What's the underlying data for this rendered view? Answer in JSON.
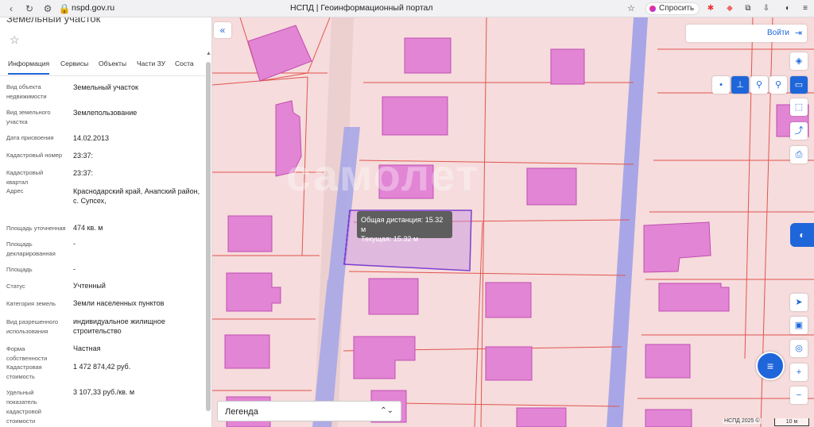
{
  "browser": {
    "url": "nspd.gov.ru",
    "tab_title": "НСПД | Геоинформационный портал",
    "ask_label": "Спросить",
    "icons": [
      "back-icon",
      "reload-icon",
      "site-settings-icon",
      "bookmark-icon",
      "extensions-icon",
      "download-icon",
      "menu-icon"
    ]
  },
  "panel": {
    "title": "Земельный участок",
    "tabs": [
      "Информация",
      "Сервисы",
      "Объекты",
      "Части ЗУ",
      "Соста"
    ],
    "rows": [
      {
        "label": "Вид объекта недвижимости",
        "value": "Земельный участок"
      },
      {
        "label": "Вид земельного участка",
        "value": "Землепользование"
      },
      {
        "label": "Дата присвоения",
        "value": "14.02.2013"
      },
      {
        "label": "Кадастровый номер",
        "value": "23:37:"
      },
      {
        "label": "Кадастровый квартал",
        "value": "23:37:"
      },
      {
        "label": "Адрес",
        "value": "Краснодарский край, Анапский район, с. Супсех,"
      },
      {
        "label": "Площадь уточненная",
        "value": "474 кв. м"
      },
      {
        "label": "Площадь декларированная",
        "value": "-"
      },
      {
        "label": "Площадь",
        "value": "-"
      },
      {
        "label": "Статус",
        "value": "Учтенный"
      },
      {
        "label": "Категория земель",
        "value": "Земли населенных пунктов"
      },
      {
        "label": "Вид разрешенного использования",
        "value": "индивидуальное жилищное строительство"
      },
      {
        "label": "Форма собственности",
        "value": "Частная"
      },
      {
        "label": "Кадастровая стоимость",
        "value": "1 472 874,42 руб."
      },
      {
        "label": "Удельный показатель кадастровой стоимости",
        "value": "3 107,33 руб./кв. м"
      }
    ]
  },
  "map": {
    "login_label": "Войти",
    "tooltip_total": "Общая дистанция: 15.32 м",
    "tooltip_current": "Текущая: 15.32 м",
    "legend_label": "Легенда",
    "attribution": "НСПД 2025 ©",
    "scale_label": "10 м",
    "watermark": "самолет",
    "colors": {
      "parcel_fill": "#f6dcdc",
      "parcel_line": "#e0554f",
      "building": "#e285d4",
      "road": "#a8a6e6",
      "selection": "#7d3fd0",
      "accent": "#1e66d9"
    }
  }
}
